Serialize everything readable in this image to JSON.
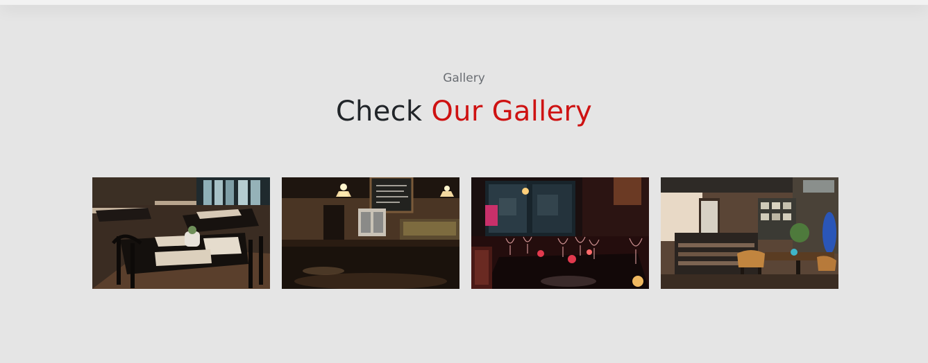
{
  "header": {},
  "gallery": {
    "label": "Gallery",
    "title_prefix": "Check",
    "title_accent": "Our Gallery",
    "accent_color": "#ce1212",
    "images": [
      {
        "subject": "restaurant-tables-image"
      },
      {
        "subject": "bar-interior-image"
      },
      {
        "subject": "wine-glasses-table-image"
      },
      {
        "subject": "cafe-interior-image"
      }
    ]
  }
}
